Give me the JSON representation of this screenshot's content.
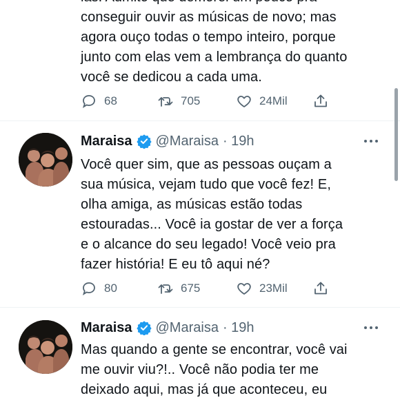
{
  "tweets": [
    {
      "partial_top_line": "las. Admito que demorei um pouco pra",
      "text": "conseguir ouvir as músicas de novo; mas\nagora ouço todas o tempo inteiro, porque\njunto com elas vem a lembrança do quanto\nvocê se dedicou a cada uma.",
      "replies": "68",
      "retweets": "705",
      "likes": "24Mil"
    },
    {
      "name": "Maraisa",
      "handle": "@Maraisa",
      "time": "· 19h",
      "text": "Você quer sim, que as pessoas ouçam a\nsua música, vejam tudo que você fez! E,\nolha amiga, as músicas estão todas\nestouradas... Você ia gostar de ver a força\ne o alcance do seu legado! Você veio pra\nfazer história! E eu tô aqui né?",
      "replies": "80",
      "retweets": "675",
      "likes": "23Mil"
    },
    {
      "name": "Maraisa",
      "handle": "@Maraisa",
      "time": "· 19h",
      "text": "Mas quando a gente se encontrar, você vai\nme ouvir viu?!.. Você não podia ter me\ndeixado aqui, mas já que aconteceu, eu"
    }
  ],
  "colors": {
    "text": "#0f1419",
    "secondary": "#536471",
    "verified": "#1d9bf0",
    "divider": "#eff3f4"
  }
}
